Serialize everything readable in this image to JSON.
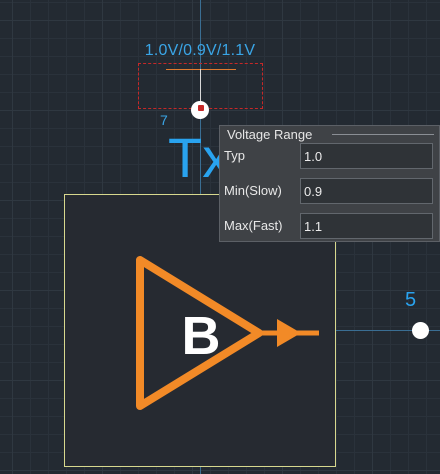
{
  "supply": {
    "label": "1.0V/0.9V/1.1V"
  },
  "pin_top_mark": "7",
  "reference_label": "Tx",
  "component": {
    "glyph": "B"
  },
  "right_pin": {
    "number": "5"
  },
  "voltage_panel": {
    "title": "Voltage Range",
    "rows": [
      {
        "label": "Typ",
        "value": "1.0"
      },
      {
        "label": "Min(Slow)",
        "value": "0.9"
      },
      {
        "label": "Max(Fast)",
        "value": "1.1"
      }
    ]
  },
  "colors": {
    "grid_background": "#232a32",
    "net_blue": "#29a3ef",
    "buffer_orange": "#f28a27",
    "dashed_red": "#c62828",
    "block_border": "#d7d88e"
  },
  "icons": [
    "buffer-triangle-icon",
    "pin-dot-icon"
  ]
}
